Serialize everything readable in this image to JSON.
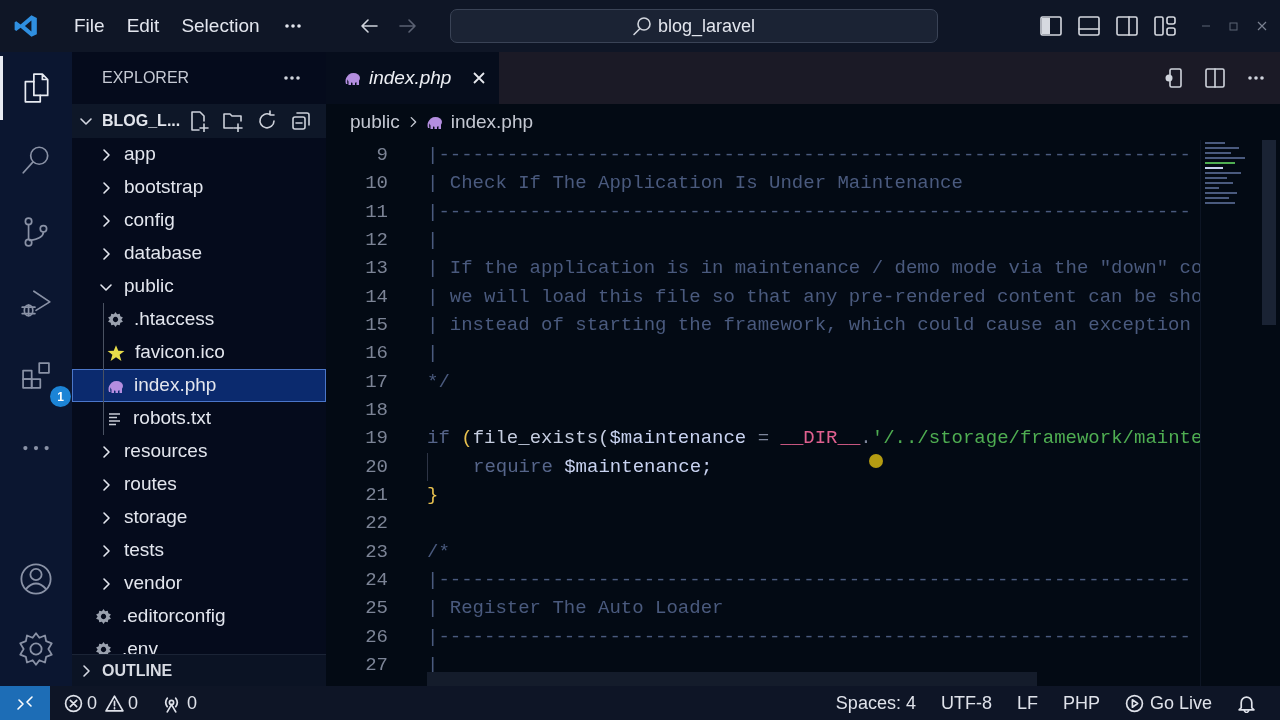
{
  "title_bar": {
    "menus": [
      "File",
      "Edit",
      "Selection"
    ],
    "search": {
      "value": "blog_laravel"
    }
  },
  "activity_bar": {
    "items": [
      {
        "kind": "explorer",
        "selected": true
      },
      {
        "kind": "search",
        "selected": false
      },
      {
        "kind": "source-control",
        "selected": false
      },
      {
        "kind": "run-debug",
        "selected": false
      },
      {
        "kind": "extensions",
        "selected": false,
        "badge": "1"
      },
      {
        "kind": "more",
        "selected": false
      }
    ],
    "bottom_items": [
      {
        "kind": "account"
      },
      {
        "kind": "settings"
      }
    ]
  },
  "sidebar": {
    "title": "EXPLORER",
    "root": {
      "label": "BLOG_L...",
      "expanded": true
    },
    "tree": [
      {
        "kind": "folder",
        "label": "app",
        "expanded": false
      },
      {
        "kind": "folder",
        "label": "bootstrap",
        "expanded": false
      },
      {
        "kind": "folder",
        "label": "config",
        "expanded": false
      },
      {
        "kind": "folder",
        "label": "database",
        "expanded": false
      },
      {
        "kind": "folder",
        "label": "public",
        "expanded": true,
        "children": [
          {
            "kind": "config",
            "label": ".htaccess",
            "selected": false
          },
          {
            "kind": "favicon",
            "label": "favicon.ico",
            "selected": false
          },
          {
            "kind": "php",
            "label": "index.php",
            "selected": true
          },
          {
            "kind": "text",
            "label": "robots.txt",
            "selected": false
          }
        ]
      },
      {
        "kind": "folder",
        "label": "resources",
        "expanded": false
      },
      {
        "kind": "folder",
        "label": "routes",
        "expanded": false
      },
      {
        "kind": "folder",
        "label": "storage",
        "expanded": false
      },
      {
        "kind": "folder",
        "label": "tests",
        "expanded": false
      },
      {
        "kind": "folder",
        "label": "vendor",
        "expanded": false
      },
      {
        "kind": "config",
        "label": ".editorconfig",
        "selected": false
      },
      {
        "kind": "config",
        "label": ".env",
        "selected": false
      }
    ],
    "outline": {
      "label": "OUTLINE",
      "expanded": false
    }
  },
  "editor": {
    "tabs": [
      {
        "label": "index.php",
        "preview": true,
        "selected": true
      }
    ],
    "breadcrumbs": [
      {
        "kind": "folder",
        "label": "public"
      },
      {
        "kind": "php",
        "label": "index.php"
      }
    ],
    "lines": [
      {
        "number": "9",
        "tokens": [
          {
            "kind": "comment",
            "text": "|------------------------------------------------------------------"
          }
        ]
      },
      {
        "number": "10",
        "tokens": [
          {
            "kind": "comment",
            "text": "| Check If The Application Is Under Maintenance"
          }
        ]
      },
      {
        "number": "11",
        "tokens": [
          {
            "kind": "comment",
            "text": "|------------------------------------------------------------------"
          }
        ]
      },
      {
        "number": "12",
        "tokens": [
          {
            "kind": "comment",
            "text": "|"
          }
        ]
      },
      {
        "number": "13",
        "tokens": [
          {
            "kind": "comment",
            "text": "| If the application is in maintenance / demo mode via the \"down\" co"
          }
        ]
      },
      {
        "number": "14",
        "tokens": [
          {
            "kind": "comment",
            "text": "| we will load this file so that any pre-rendered content can be sho"
          }
        ]
      },
      {
        "number": "15",
        "tokens": [
          {
            "kind": "comment",
            "text": "| instead of starting the framework, which could cause an exception"
          }
        ]
      },
      {
        "number": "16",
        "tokens": [
          {
            "kind": "comment",
            "text": "|"
          }
        ]
      },
      {
        "number": "17",
        "tokens": [
          {
            "kind": "comment",
            "text": "*/"
          }
        ]
      },
      {
        "number": "18"
      },
      {
        "number": "19",
        "tokens": [
          {
            "kind": "keyword",
            "text": "if "
          },
          {
            "kind": "bracket",
            "text": "("
          },
          {
            "kind": "function",
            "text": "file_exists("
          },
          {
            "kind": "variable",
            "text": "$maintenance"
          },
          {
            "kind": "operator",
            "text": " = "
          },
          {
            "kind": "constant",
            "text": "__DIR__"
          },
          {
            "kind": "operator",
            "text": "."
          },
          {
            "kind": "string",
            "text": "'/../storage/framework/mainte"
          }
        ]
      },
      {
        "number": "20",
        "indented": true,
        "tokens": [
          {
            "kind": "keyword",
            "text": "require "
          },
          {
            "kind": "variable",
            "text": "$maintenance;"
          }
        ]
      },
      {
        "number": "21",
        "tokens": [
          {
            "kind": "bracket",
            "text": "}"
          }
        ]
      },
      {
        "number": "22"
      },
      {
        "number": "23",
        "tokens": [
          {
            "kind": "comment",
            "text": "/*"
          }
        ]
      },
      {
        "number": "24",
        "tokens": [
          {
            "kind": "comment",
            "text": "|------------------------------------------------------------------"
          }
        ]
      },
      {
        "number": "25",
        "tokens": [
          {
            "kind": "comment",
            "text": "| Register The Auto Loader"
          }
        ]
      },
      {
        "number": "26",
        "tokens": [
          {
            "kind": "comment",
            "text": "|------------------------------------------------------------------"
          }
        ]
      },
      {
        "number": "27",
        "tokens": [
          {
            "kind": "comment",
            "text": "|"
          }
        ]
      }
    ]
  },
  "status_bar": {
    "errors": "0",
    "warnings": "0",
    "ports": "0",
    "items": [
      "Spaces: 4",
      "UTF-8",
      "LF",
      "PHP"
    ],
    "go_live": "Go Live"
  }
}
